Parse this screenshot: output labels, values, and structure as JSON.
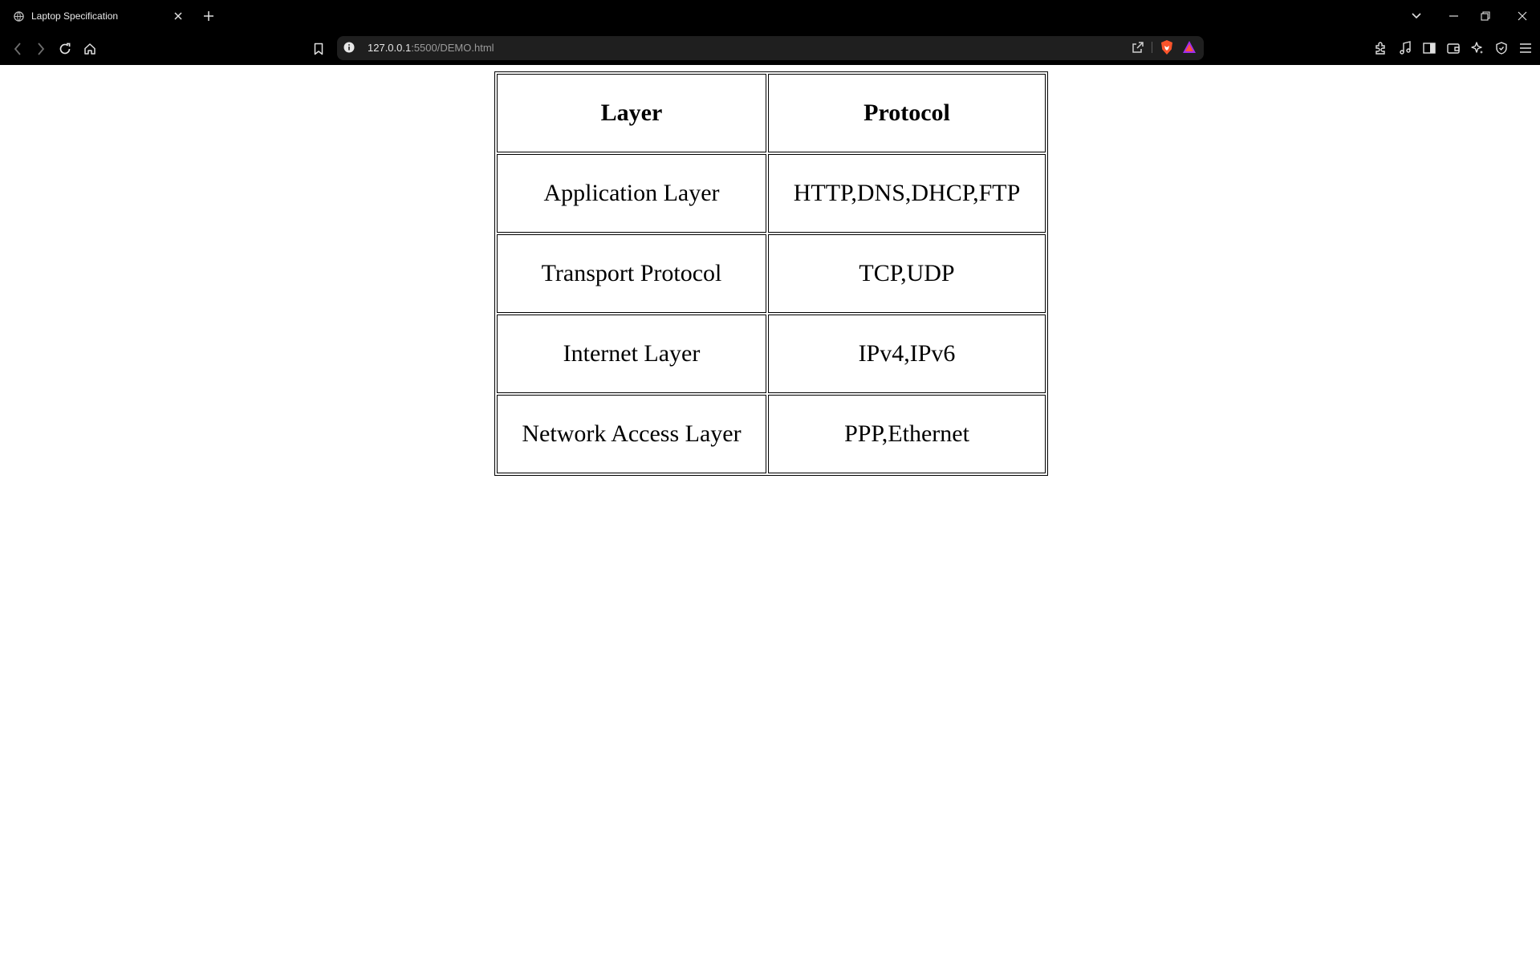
{
  "browser": {
    "tab": {
      "title": "Laptop Specification",
      "favicon": "globe-icon",
      "close_icon": "close-icon"
    },
    "new_tab_icon": "plus-icon",
    "window_controls": [
      "chevron-down-icon",
      "minimize-icon",
      "restore-icon",
      "close-icon"
    ],
    "nav_icons": [
      "back-icon",
      "forward-icon",
      "reload-icon",
      "home-icon",
      "bookmark-icon"
    ],
    "address_bar": {
      "host": "127.0.0.1",
      "rest": ":5500/DEMO.html",
      "icons": [
        "info-icon",
        "share-icon",
        "brave-shields-icon",
        "brave-rewards-icon"
      ]
    },
    "extension_icons": [
      "extensions-icon",
      "music-icon",
      "sidebar-icon",
      "wallet-icon",
      "leo-ai-icon",
      "vpn-icon",
      "menu-icon"
    ],
    "colors": {
      "chrome_bg": "#000000",
      "omnibox_bg": "#1f1f1f",
      "brave_orange": "#fb542b"
    }
  },
  "table": {
    "headers": [
      "Layer",
      "Protocol"
    ],
    "rows": [
      [
        "Application Layer",
        "HTTP,DNS,DHCP,FTP"
      ],
      [
        "Transport Protocol",
        "TCP,UDP"
      ],
      [
        "Internet Layer",
        "IPv4,IPv6"
      ],
      [
        "Network Access Layer",
        "PPP,Ethernet"
      ]
    ]
  }
}
